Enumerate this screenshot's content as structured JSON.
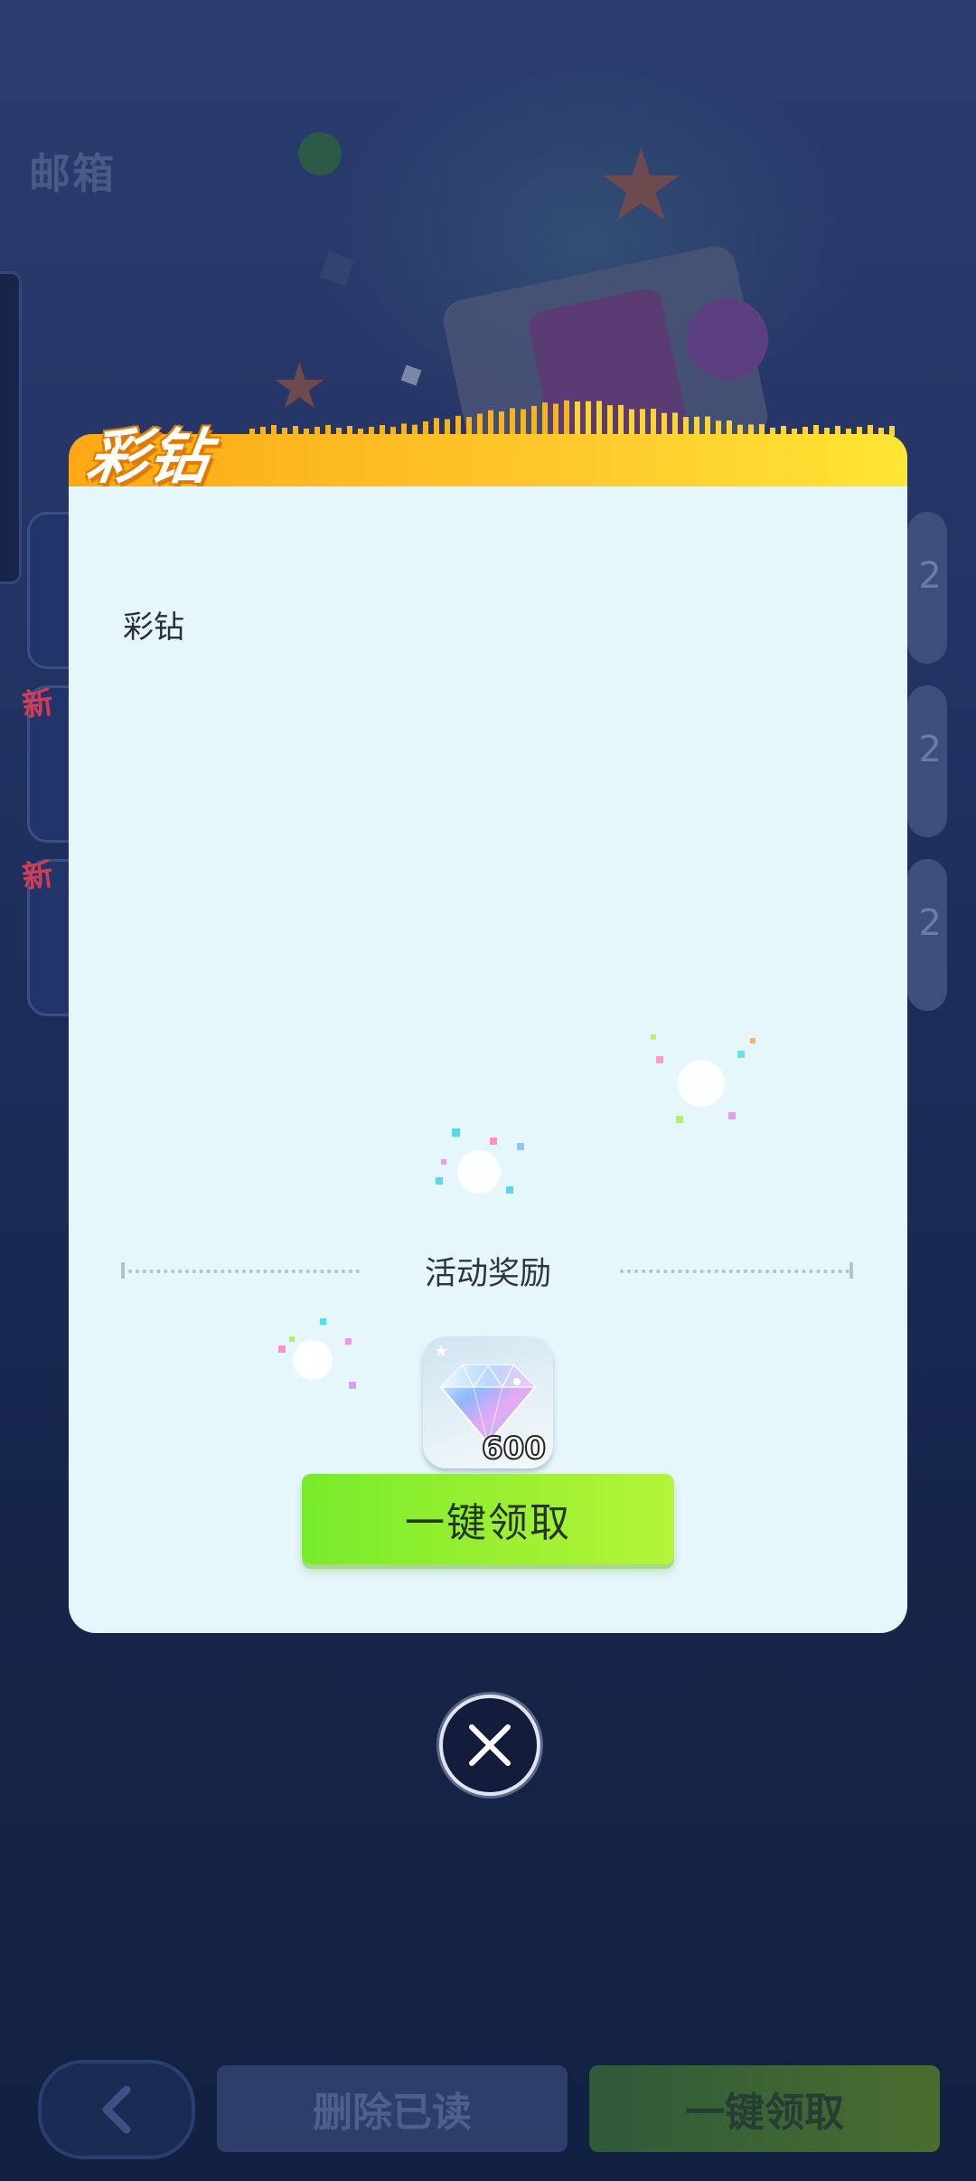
{
  "background": {
    "page_title": "邮箱",
    "new_badge": "新",
    "right_card_digit": "2",
    "back_icon": "chevron-left-icon",
    "delete_read_label": "删除已读",
    "claim_all_label": "一键领取"
  },
  "modal": {
    "title": "彩钻",
    "mail_body": "彩钻",
    "reward_section_label": "活动奖励",
    "reward": {
      "icon": "diamond-icon",
      "count": "600"
    },
    "claim_button_label": "一键领取",
    "close_icon": "close-icon"
  },
  "colors": {
    "header_gradient_start": "#fba813",
    "header_gradient_end": "#ffe534",
    "modal_background": "#e6f7fc",
    "claim_button_start": "#77ec2a",
    "claim_button_end": "#b4f53a",
    "page_background": "#1d2d5b"
  }
}
